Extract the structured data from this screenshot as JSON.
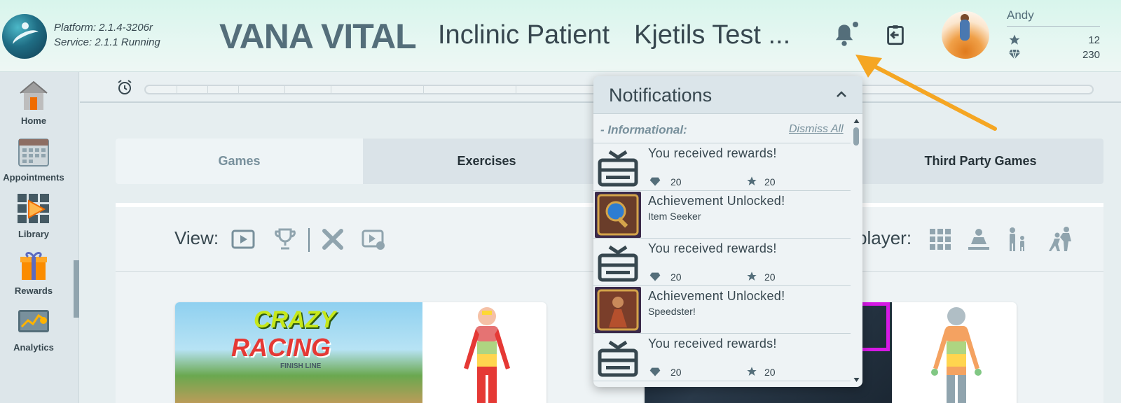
{
  "header": {
    "platform_line": "Platform: 2.1.4-3206r",
    "service_line": "Service:   2.1.1 Running",
    "brand": "VANA VITAL",
    "mode": "Inclinic Patient",
    "patient": "Kjetils Test ...",
    "bell_icon": "bell-icon",
    "exit_icon": "exit-icon",
    "user": {
      "name": "Andy",
      "stars": "12",
      "gems": "230"
    }
  },
  "sidebar": {
    "items": [
      {
        "label": "Home",
        "icon": "home-icon"
      },
      {
        "label": "Appointments",
        "icon": "calendar-icon"
      },
      {
        "label": "Library",
        "icon": "library-icon"
      },
      {
        "label": "Rewards",
        "icon": "gift-icon"
      },
      {
        "label": "Analytics",
        "icon": "analytics-icon"
      }
    ],
    "active": "Library"
  },
  "tabs": [
    {
      "label": "Games",
      "active": true
    },
    {
      "label": "Exercises",
      "active": false
    },
    {
      "label": "Third Party Games",
      "active": false
    }
  ],
  "view": {
    "label": "View:",
    "player_label": "player:"
  },
  "games": [
    {
      "title_line1": "CRAZY",
      "title_line2": "RACING",
      "subtitle": "FINISH LINE"
    }
  ],
  "notifications": {
    "title": "Notifications",
    "section": "- Informational:",
    "dismiss_all": "Dismiss All",
    "items": [
      {
        "type": "reward",
        "title": "You received rewards!",
        "gems": "20",
        "stars": "20"
      },
      {
        "type": "achievement",
        "title": "Achievement Unlocked!",
        "subtitle": "Item Seeker"
      },
      {
        "type": "reward",
        "title": "You received rewards!",
        "gems": "20",
        "stars": "20"
      },
      {
        "type": "achievement",
        "title": "Achievement Unlocked!",
        "subtitle": "Speedster!"
      },
      {
        "type": "reward",
        "title": "You received rewards!",
        "gems": "20",
        "stars": "20"
      }
    ]
  },
  "colors": {
    "accent": "#546e7a",
    "arrow": "#f5a623",
    "header_bg": "#d8f5ec"
  }
}
